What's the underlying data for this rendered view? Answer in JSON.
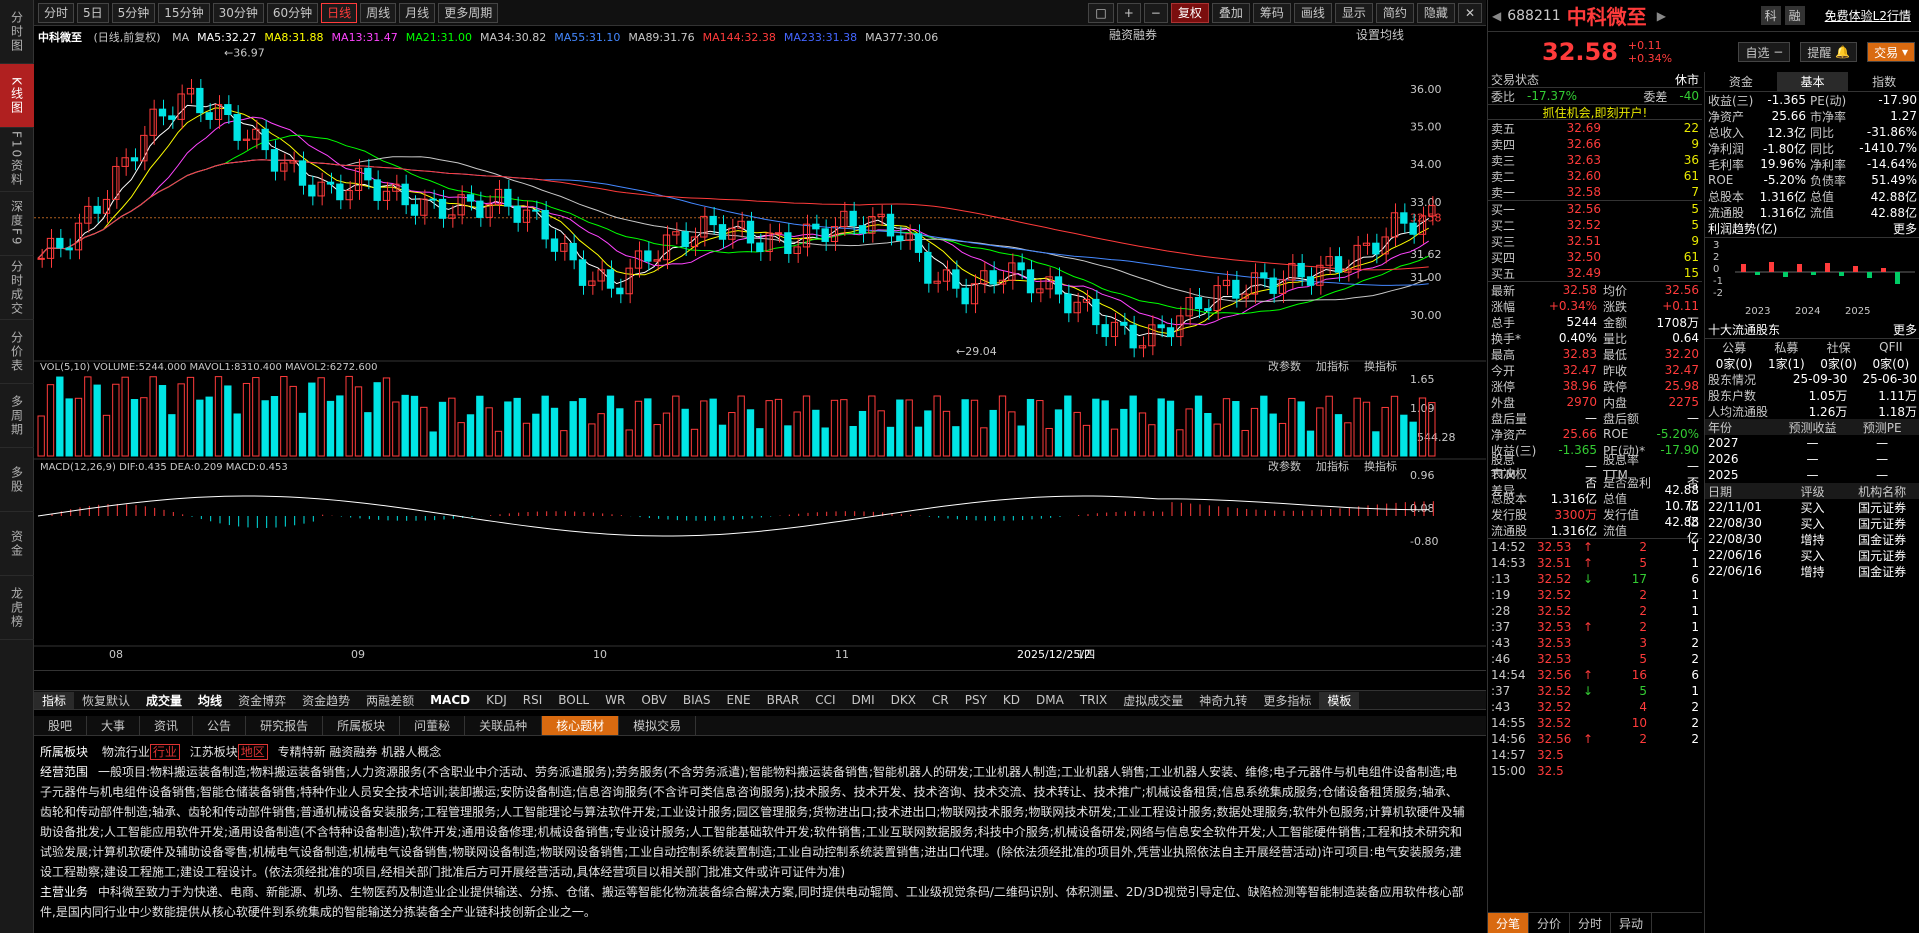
{
  "left_nav": [
    "分时图",
    "K线图",
    "F10资料",
    "深度F9",
    "分时成交",
    "分价表",
    "多周期",
    "多股",
    "资金",
    "龙虎榜"
  ],
  "periods": [
    "分时",
    "5日",
    "5分钟",
    "15分钟",
    "30分钟",
    "60分钟",
    "日线",
    "周线",
    "月线",
    "更多周期"
  ],
  "toolbar": {
    "fuquan": "复权",
    "diejia": "叠加",
    "chouma": "筹码",
    "huaxian": "画线",
    "xianshi": "显示",
    "jianyue": "简约",
    "yincang": "隐藏"
  },
  "chart": {
    "title": "中科微至",
    "subtitle": "(日线,前复权)",
    "ma_items": [
      {
        "label": "MA",
        "color": "#c8c8c8"
      },
      {
        "label": "MA5:32.27",
        "color": "#ffffff"
      },
      {
        "label": "MA8:31.88",
        "color": "#ffff00"
      },
      {
        "label": "MA13:31.47",
        "color": "#ff44ff"
      },
      {
        "label": "MA21:31.00",
        "color": "#00ff00"
      },
      {
        "label": "MA34:30.82",
        "color": "#c8c8c8"
      },
      {
        "label": "MA55:31.10",
        "color": "#4488ff"
      },
      {
        "label": "MA89:31.76",
        "color": "#c8c8c8"
      },
      {
        "label": "MA144:32.38",
        "color": "#ff3b3b"
      },
      {
        "label": "MA233:31.38",
        "color": "#4466ff"
      },
      {
        "label": "MA377:30.06",
        "color": "#c8c8c8"
      }
    ],
    "rongzi": "融资融券",
    "shezhi": "设置均线",
    "price_labels": [
      "36.00",
      "35.00",
      "34.00",
      "33.00",
      "32.58",
      "31.62",
      "31.00",
      "30.00"
    ],
    "high_label": "36.97",
    "low_label": "29.04",
    "vol_header": {
      "name": "VOL(5,10)",
      "volume": "VOLUME:5244.000",
      "m1": "MAVOL1:8310.400",
      "m2": "MAVOL2:6272.600"
    },
    "vol_labels": [
      "1.65",
      "1.09",
      "5544.28"
    ],
    "macd_header": {
      "name": "MACD(12,26,9)",
      "dif": "DIF:0.435",
      "dea": "DEA:0.209",
      "macd": "MACD:0.453"
    },
    "macd_labels": [
      "0.96",
      "0.08",
      "-0.80"
    ],
    "sub_btns": [
      "改参数",
      "加指标",
      "换指标"
    ],
    "x_labels": [
      "08",
      "09",
      "10",
      "11",
      "12"
    ],
    "date_label": "2025/12/25/四"
  },
  "indicators": [
    "指标",
    "恢复默认",
    "成交量",
    "均线",
    "资金博弈",
    "资金趋势",
    "两融差额",
    "MACD",
    "KDJ",
    "RSI",
    "BOLL",
    "WR",
    "OBV",
    "BIAS",
    "ENE",
    "BRAR",
    "CCI",
    "DMI",
    "DKX",
    "CR",
    "PSY",
    "KD",
    "DMA",
    "TRIX",
    "虚拟成交量",
    "神奇九转",
    "更多指标",
    "模板"
  ],
  "info_tabs": [
    "股吧",
    "大事",
    "资讯",
    "公告",
    "研究报告",
    "所属板块",
    "问董秘",
    "关联品种",
    "核心题材",
    "模拟交易"
  ],
  "info": {
    "bk_head": "所属板块",
    "bk1": "物流行业",
    "bk1tag": "行业",
    "bk2": "江苏板块",
    "bk2tag": "地区",
    "bk3": "专精特新 融资融券 机器人概念",
    "jy_head": "经营范围",
    "jy_text": "一般项目:物料搬运装备制造;物料搬运装备销售;人力资源服务(不含职业中介活动、劳务派遣服务);劳务服务(不含劳务派遣);智能物料搬运装备销售;智能机器人的研发;工业机器人制造;工业机器人销售;工业机器人安装、维修;电子元器件与机电组件设备制造;电子元器件与机电组件设备销售;智能仓储装备销售;特种作业人员安全技术培训;装卸搬运;安防设备制造;信息咨询服务(不含许可类信息咨询服务);技术服务、技术开发、技术咨询、技术交流、技术转让、技术推广;机械设备租赁;信息系统集成服务;仓储设备租赁服务;轴承、齿轮和传动部件制造;轴承、齿轮和传动部件销售;普通机械设备安装服务;工程管理服务;人工智能理论与算法软件开发;工业设计服务;园区管理服务;货物进出口;技术进出口;物联网技术服务;物联网技术研发;工业工程设计服务;数据处理服务;软件外包服务;计算机软硬件及辅助设备批发;人工智能应用软件开发;通用设备制造(不含特种设备制造);软件开发;通用设备修理;机械设备销售;专业设计服务;人工智能基础软件开发;软件销售;工业互联网数据服务;科技中介服务;机械设备研发;网络与信息安全软件开发;人工智能硬件销售;工程和技术研究和试验发展;计算机软硬件及辅助设备零售;机械电气设备制造;机械电气设备销售;物联网设备制造;物联网设备销售;工业自动控制系统装置制造;工业自动控制系统装置销售;进出口代理。(除依法须经批准的项目外,凭营业执照依法自主开展经营活动)许可项目:电气安装服务;建设工程勘察;建设工程施工;建设工程设计。(依法须经批准的项目,经相关部门批准后方可开展经营活动,具体经营项目以相关部门批准文件或许可证件为准)",
    "zy_head": "主营业务",
    "zy_text": "中科微至致力于为快递、电商、新能源、机场、生物医药及制造业企业提供输送、分拣、仓储、搬运等智能化物流装备综合解决方案,同时提供电动辊筒、工业级视觉条码/二维码识别、体积测量、2D/3D视觉引导定位、缺陷检测等智能制造装备应用软件核心部件,是国内同行业中少数能提供从核心软硬件到系统集成的智能输送分拣装备全产业链科技创新企业之一。"
  },
  "quote": {
    "code": "688211",
    "name": "中科微至",
    "price": "32.58",
    "chg": "+0.11",
    "pct": "+0.34%",
    "btn_ke": "科",
    "btn_rong": "融",
    "l2": "免费体验L2行情",
    "zixuan": "自选",
    "tixing": "提醒",
    "jiaoyi": "交易",
    "state_label": "交易状态",
    "state": "休市",
    "weibi_l": "委比",
    "weibi": "-17.37%",
    "weicha_l": "委差",
    "weicha": "-40",
    "ad": "抓住机会,即刻开户!",
    "asks": [
      [
        "卖五",
        "32.69",
        "22"
      ],
      [
        "卖四",
        "32.66",
        "9"
      ],
      [
        "卖三",
        "32.63",
        "36"
      ],
      [
        "卖二",
        "32.60",
        "61"
      ],
      [
        "卖一",
        "32.58",
        "7"
      ]
    ],
    "bids": [
      [
        "买一",
        "32.56",
        "5"
      ],
      [
        "买二",
        "32.52",
        "5"
      ],
      [
        "买三",
        "32.51",
        "9"
      ],
      [
        "买四",
        "32.50",
        "61"
      ],
      [
        "买五",
        "32.49",
        "15"
      ]
    ],
    "stats": [
      [
        "最新",
        "32.58",
        "均价",
        "32.56"
      ],
      [
        "涨幅",
        "+0.34%",
        "涨跌",
        "+0.11"
      ],
      [
        "总手",
        "5244",
        "金额",
        "1708万"
      ],
      [
        "换手*",
        "0.40%",
        "量比",
        "0.64"
      ],
      [
        "最高",
        "32.83",
        "最低",
        "32.20"
      ],
      [
        "今开",
        "32.47",
        "昨收",
        "32.47"
      ],
      [
        "涨停",
        "38.96",
        "跌停",
        "25.98"
      ],
      [
        "外盘",
        "2970",
        "内盘",
        "2275"
      ],
      [
        "盘后量",
        "—",
        "盘后额",
        "—"
      ],
      [
        "净资产",
        "25.66",
        "ROE",
        "-5.20%"
      ],
      [
        "收益(三)",
        "-1.365",
        "PE(动)*",
        "-17.90"
      ],
      [
        "股息TTM",
        "—",
        "股息率TTM",
        "—"
      ],
      [
        "表决权差异",
        "否",
        "是否盈利",
        "否"
      ],
      [
        "总股本",
        "1.316亿",
        "总值",
        "42.88亿"
      ],
      [
        "发行股",
        "3300万",
        "发行值",
        "10.75亿"
      ],
      [
        "流通股",
        "1.316亿",
        "流值",
        "42.88亿"
      ]
    ],
    "ticks": [
      [
        "14:52",
        "32.53",
        "up",
        "2",
        "1"
      ],
      [
        "14:53",
        "32.51",
        "up",
        "5",
        "1"
      ],
      [
        ":13",
        "32.52",
        "down",
        "17",
        "6"
      ],
      [
        ":19",
        "32.52",
        "",
        "2",
        "1"
      ],
      [
        ":28",
        "32.52",
        "",
        "2",
        "1"
      ],
      [
        ":37",
        "32.53",
        "up",
        "2",
        "1"
      ],
      [
        ":43",
        "32.53",
        "",
        "3",
        "2"
      ],
      [
        ":46",
        "32.53",
        "",
        "5",
        "2"
      ],
      [
        "14:54",
        "32.56",
        "up",
        "16",
        "6"
      ],
      [
        ":37",
        "32.52",
        "down",
        "5",
        "1"
      ],
      [
        ":43",
        "32.52",
        "",
        "4",
        "2"
      ],
      [
        "14:55",
        "32.52",
        "",
        "10",
        "2"
      ],
      [
        "14:56",
        "32.56",
        "up",
        "2",
        "2"
      ],
      [
        "14:57",
        "32.5",
        "",
        "",
        ""
      ],
      [
        "15:00",
        "32.5",
        "",
        "",
        ""
      ]
    ],
    "bottom_tabs": [
      "分笔",
      "分价",
      "分时",
      "异动"
    ]
  },
  "fund": {
    "tabs": [
      "资金",
      "基本",
      "指数"
    ],
    "rows": [
      [
        "收益(三)",
        "-1.365",
        "PE(动)",
        "-17.90"
      ],
      [
        "净资产",
        "25.66",
        "市净率",
        "1.27"
      ],
      [
        "总收入",
        "12.3亿",
        "同比",
        "-31.86%"
      ],
      [
        "净利润",
        "-1.80亿",
        "同比",
        "-1410.7%"
      ],
      [
        "毛利率",
        "19.96%",
        "净利率",
        "-14.64%"
      ],
      [
        "ROE",
        "-5.20%",
        "负债率",
        "51.49%"
      ],
      [
        "总股本",
        "1.316亿",
        "总值",
        "42.88亿"
      ],
      [
        "流通股",
        "1.316亿",
        "流值",
        "42.88亿"
      ]
    ],
    "trend_title": "利润趋势(亿)",
    "more": "更多",
    "trend_ticks": [
      "3",
      "2",
      "0",
      "-1",
      "-2"
    ],
    "trend_years": [
      "2023",
      "2024",
      "2025"
    ],
    "top10": "十大流通股东",
    "holder_heads": [
      "公募",
      "私募",
      "社保",
      "QFII"
    ],
    "holder_vals": [
      "0家(0)",
      "1家(1)",
      "0家(0)",
      "0家(0)"
    ],
    "holder_rows": [
      [
        "股东情况",
        "25-09-30",
        "25-06-30"
      ],
      [
        "股东户数",
        "1.05万",
        "1.11万"
      ],
      [
        "人均流通股",
        "1.26万",
        "1.18万"
      ]
    ],
    "fc_heads": [
      "年份",
      "预测收益",
      "预测PE"
    ],
    "fc_rows": [
      [
        "2027",
        "—",
        "—"
      ],
      [
        "2026",
        "—",
        "—"
      ],
      [
        "2025",
        "—",
        "—"
      ]
    ],
    "rate_heads": [
      "日期",
      "评级",
      "机构名称"
    ],
    "rate_rows": [
      [
        "22/11/01",
        "买入",
        "国元证券"
      ],
      [
        "22/08/30",
        "买入",
        "国元证券"
      ],
      [
        "22/08/30",
        "增持",
        "国金证券"
      ],
      [
        "22/06/16",
        "买入",
        "国元证券"
      ],
      [
        "22/06/16",
        "增持",
        "国金证券"
      ]
    ]
  }
}
